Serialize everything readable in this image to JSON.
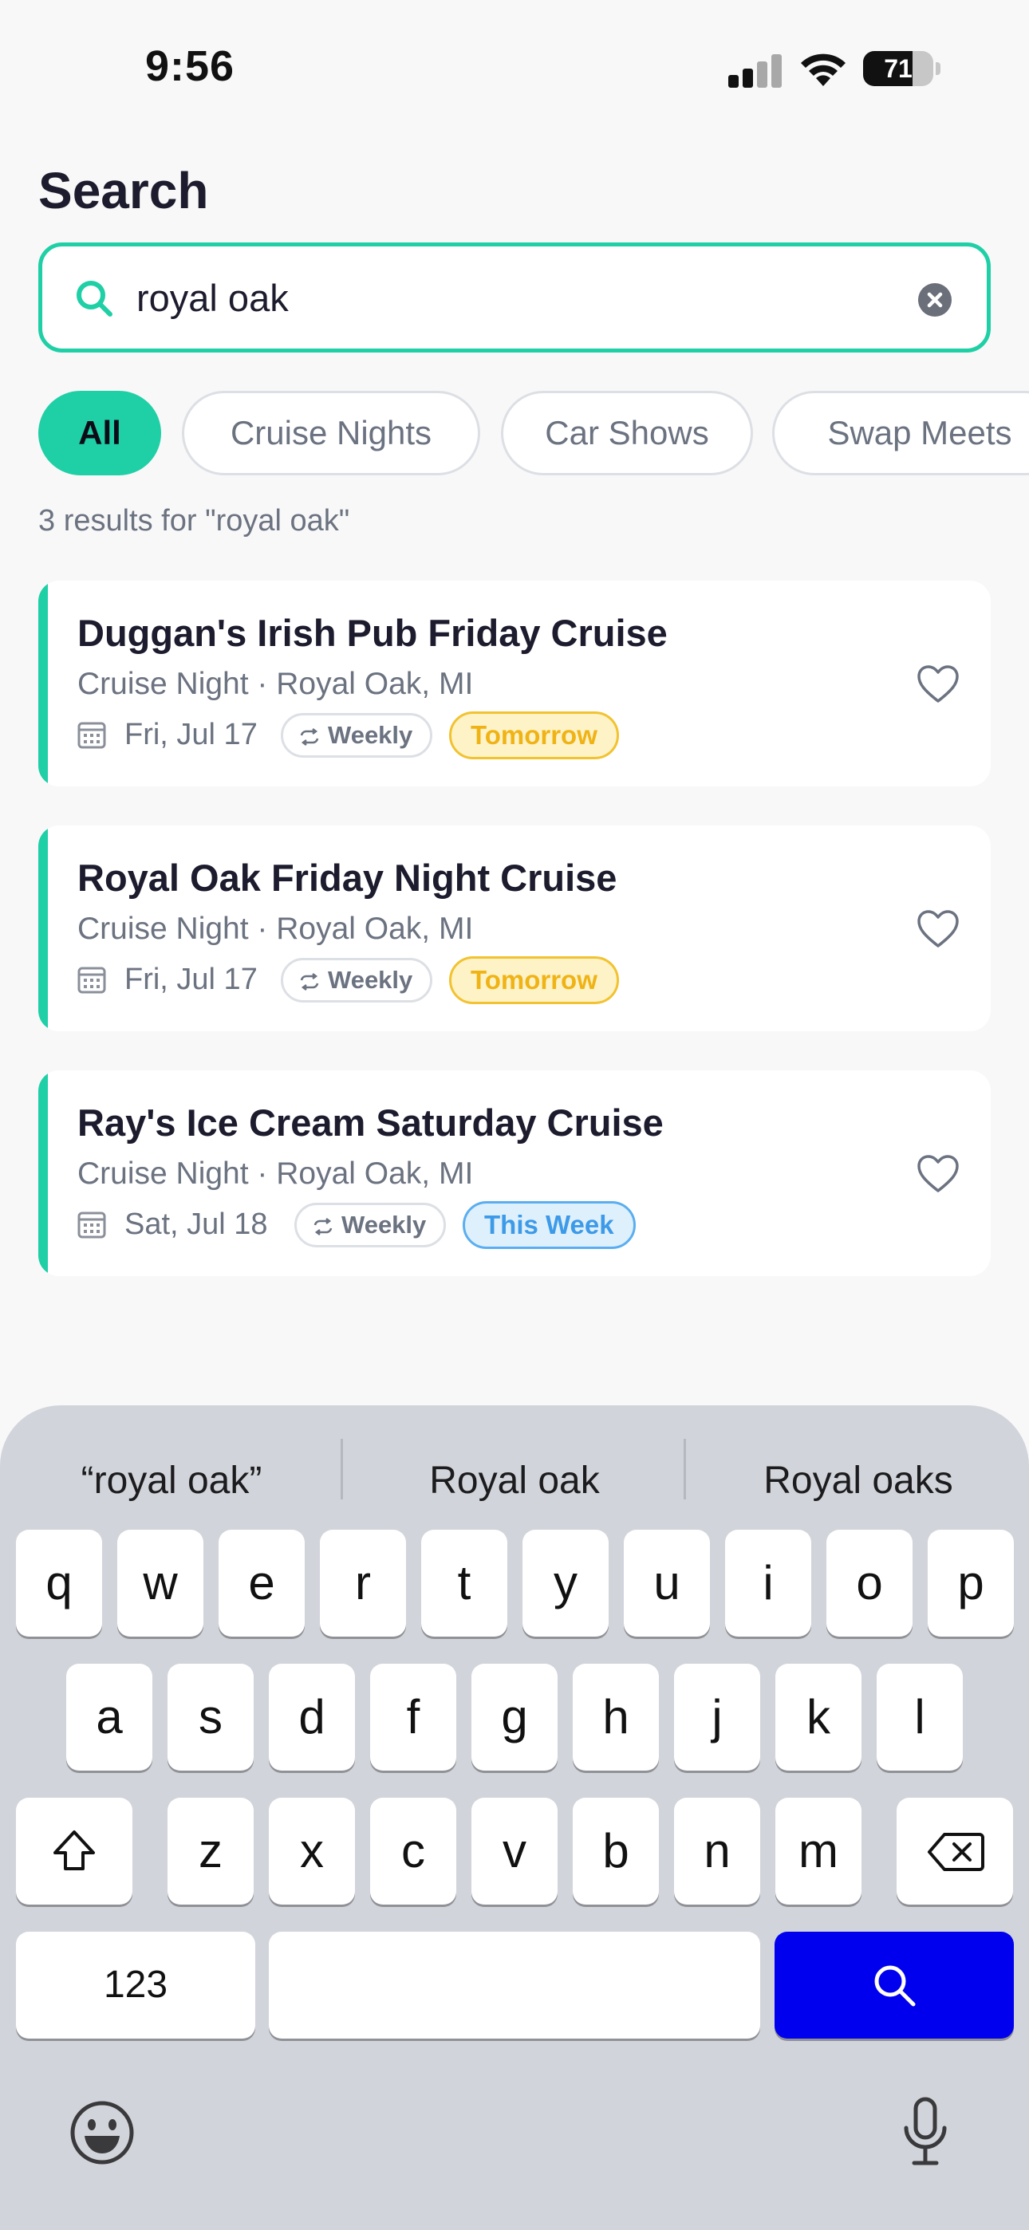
{
  "status_bar": {
    "time": "9:56",
    "battery": "71",
    "battery_level": 0.71
  },
  "page": {
    "title": "Search"
  },
  "search": {
    "value": "royal oak",
    "placeholder": ""
  },
  "filters": [
    {
      "label": "All",
      "active": true
    },
    {
      "label": "Cruise Nights",
      "active": false
    },
    {
      "label": "Car Shows",
      "active": false
    },
    {
      "label": "Swap Meets",
      "active": false
    }
  ],
  "results": {
    "summary": "3 results for \"royal oak\"",
    "items": [
      {
        "title": "Duggan's Irish Pub Friday Cruise",
        "subtitle": "Cruise Night · Royal Oak, MI",
        "date": "Fri, Jul 17",
        "frequency": "Weekly",
        "when": "Tomorrow"
      },
      {
        "title": "Royal Oak Friday Night Cruise",
        "subtitle": "Cruise Night · Royal Oak, MI",
        "date": "Fri, Jul 17",
        "frequency": "Weekly",
        "when": "Tomorrow"
      },
      {
        "title": "Ray's Ice Cream Saturday Cruise",
        "subtitle": "Cruise Night · Royal Oak, MI",
        "date": "Sat, Jul 18",
        "frequency": "Weekly",
        "when": "This Week"
      }
    ]
  },
  "keyboard": {
    "suggestions": [
      "“royal oak”",
      "Royal oak",
      "Royal oaks"
    ],
    "row1": [
      "q",
      "w",
      "e",
      "r",
      "t",
      "y",
      "u",
      "i",
      "o",
      "p"
    ],
    "row2": [
      "a",
      "s",
      "d",
      "f",
      "g",
      "h",
      "j",
      "k",
      "l"
    ],
    "row3": [
      "z",
      "x",
      "c",
      "v",
      "b",
      "n",
      "m"
    ],
    "numbers_key": "123"
  },
  "colors": {
    "accent": "#1fcfa6",
    "tomorrow": "#f0b316",
    "this_week": "#3d9ae8",
    "search_key": "#0000ee"
  }
}
